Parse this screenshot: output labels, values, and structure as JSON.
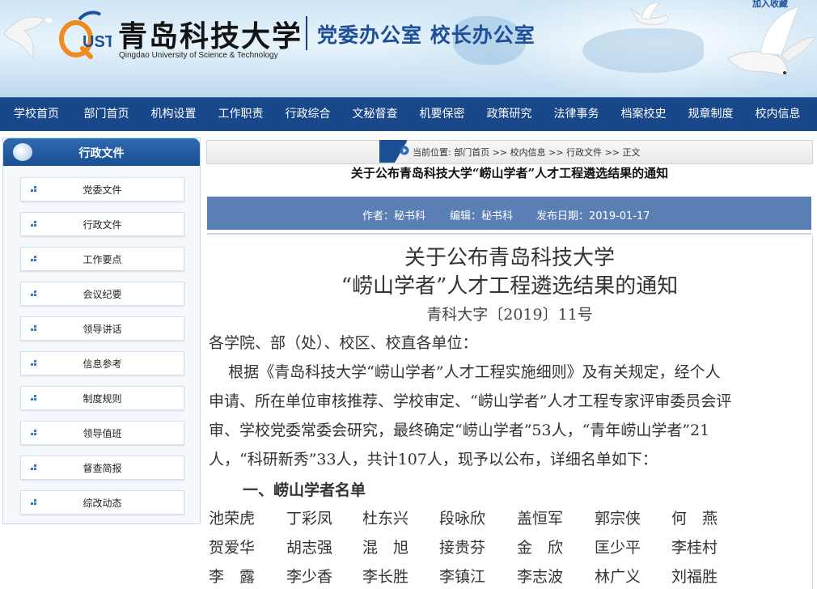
{
  "header": {
    "school_cn": "青岛科技大学",
    "school_en": "Qingdao University of Science & Technology",
    "logo_mark": "QUST",
    "office_title": "党委办公室  校长办公室",
    "topright_link": "加入收藏"
  },
  "nav": {
    "items": [
      "学校首页",
      "部门首页",
      "机构设置",
      "工作职责",
      "行政综合",
      "文秘督查",
      "机要保密",
      "政策研究",
      "法律事务",
      "档案校史",
      "规章制度",
      "校内信息"
    ]
  },
  "sidebar": {
    "title": "行政文件",
    "items": [
      "党委文件",
      "行政文件",
      "工作要点",
      "会议纪要",
      "领导讲话",
      "信息参考",
      "制度规则",
      "领导值班",
      "督查简报",
      "综改动态"
    ]
  },
  "breadcrumb": {
    "prefix": "当前位置: ",
    "path": [
      "部门首页",
      "校内信息",
      "行政文件",
      "正文"
    ],
    "separator": " >> "
  },
  "article": {
    "header_title": "关于公布青岛科技大学“崂山学者”人才工程遴选结果的通知",
    "author": "作者：秘书科",
    "editor": "编辑：秘书科",
    "date": "发布日期：2019-01-17",
    "title_line1": "关于公布青岛科技大学",
    "title_line2": "“崂山学者”人才工程遴选结果的通知",
    "doc_number": "青科大字〔2019〕11号",
    "salutation": "各学院、部（处）、校区、校直各单位：",
    "body_lines": [
      "    根据《青岛科技大学“崂山学者”人才工程实施细则》及有关规定，经个人",
      "申请、所在单位审核推荐、学校审定、“崂山学者”人才工程专家评审委员会评",
      "审、学校党委常委会研究，最终确定“崂山学者”53人，“青年崂山学者”21",
      "人，“科研新秀”33人，共计107人，现予以公布，详细名单如下："
    ],
    "section1": "一、崂山学者名单",
    "names_rows": [
      [
        "池荣虎",
        "丁彩凤",
        "杜东兴",
        "段咏欣",
        "盖恒军",
        "郭宗侠",
        "何　燕"
      ],
      [
        "贺爱华",
        "胡志强",
        "混　旭",
        "接贵芬",
        "金　欣",
        "匡少平",
        "李桂村"
      ],
      [
        "李　露",
        "李少香",
        "李长胜",
        "李镇江",
        "李志波",
        "林广义",
        "刘福胜"
      ]
    ]
  },
  "colors": {
    "nav_bg": "#18478a",
    "meta_bg": "#5a7fb5",
    "accent_blue": "#1e4f9a",
    "logo_orange": "#f08a1d"
  }
}
